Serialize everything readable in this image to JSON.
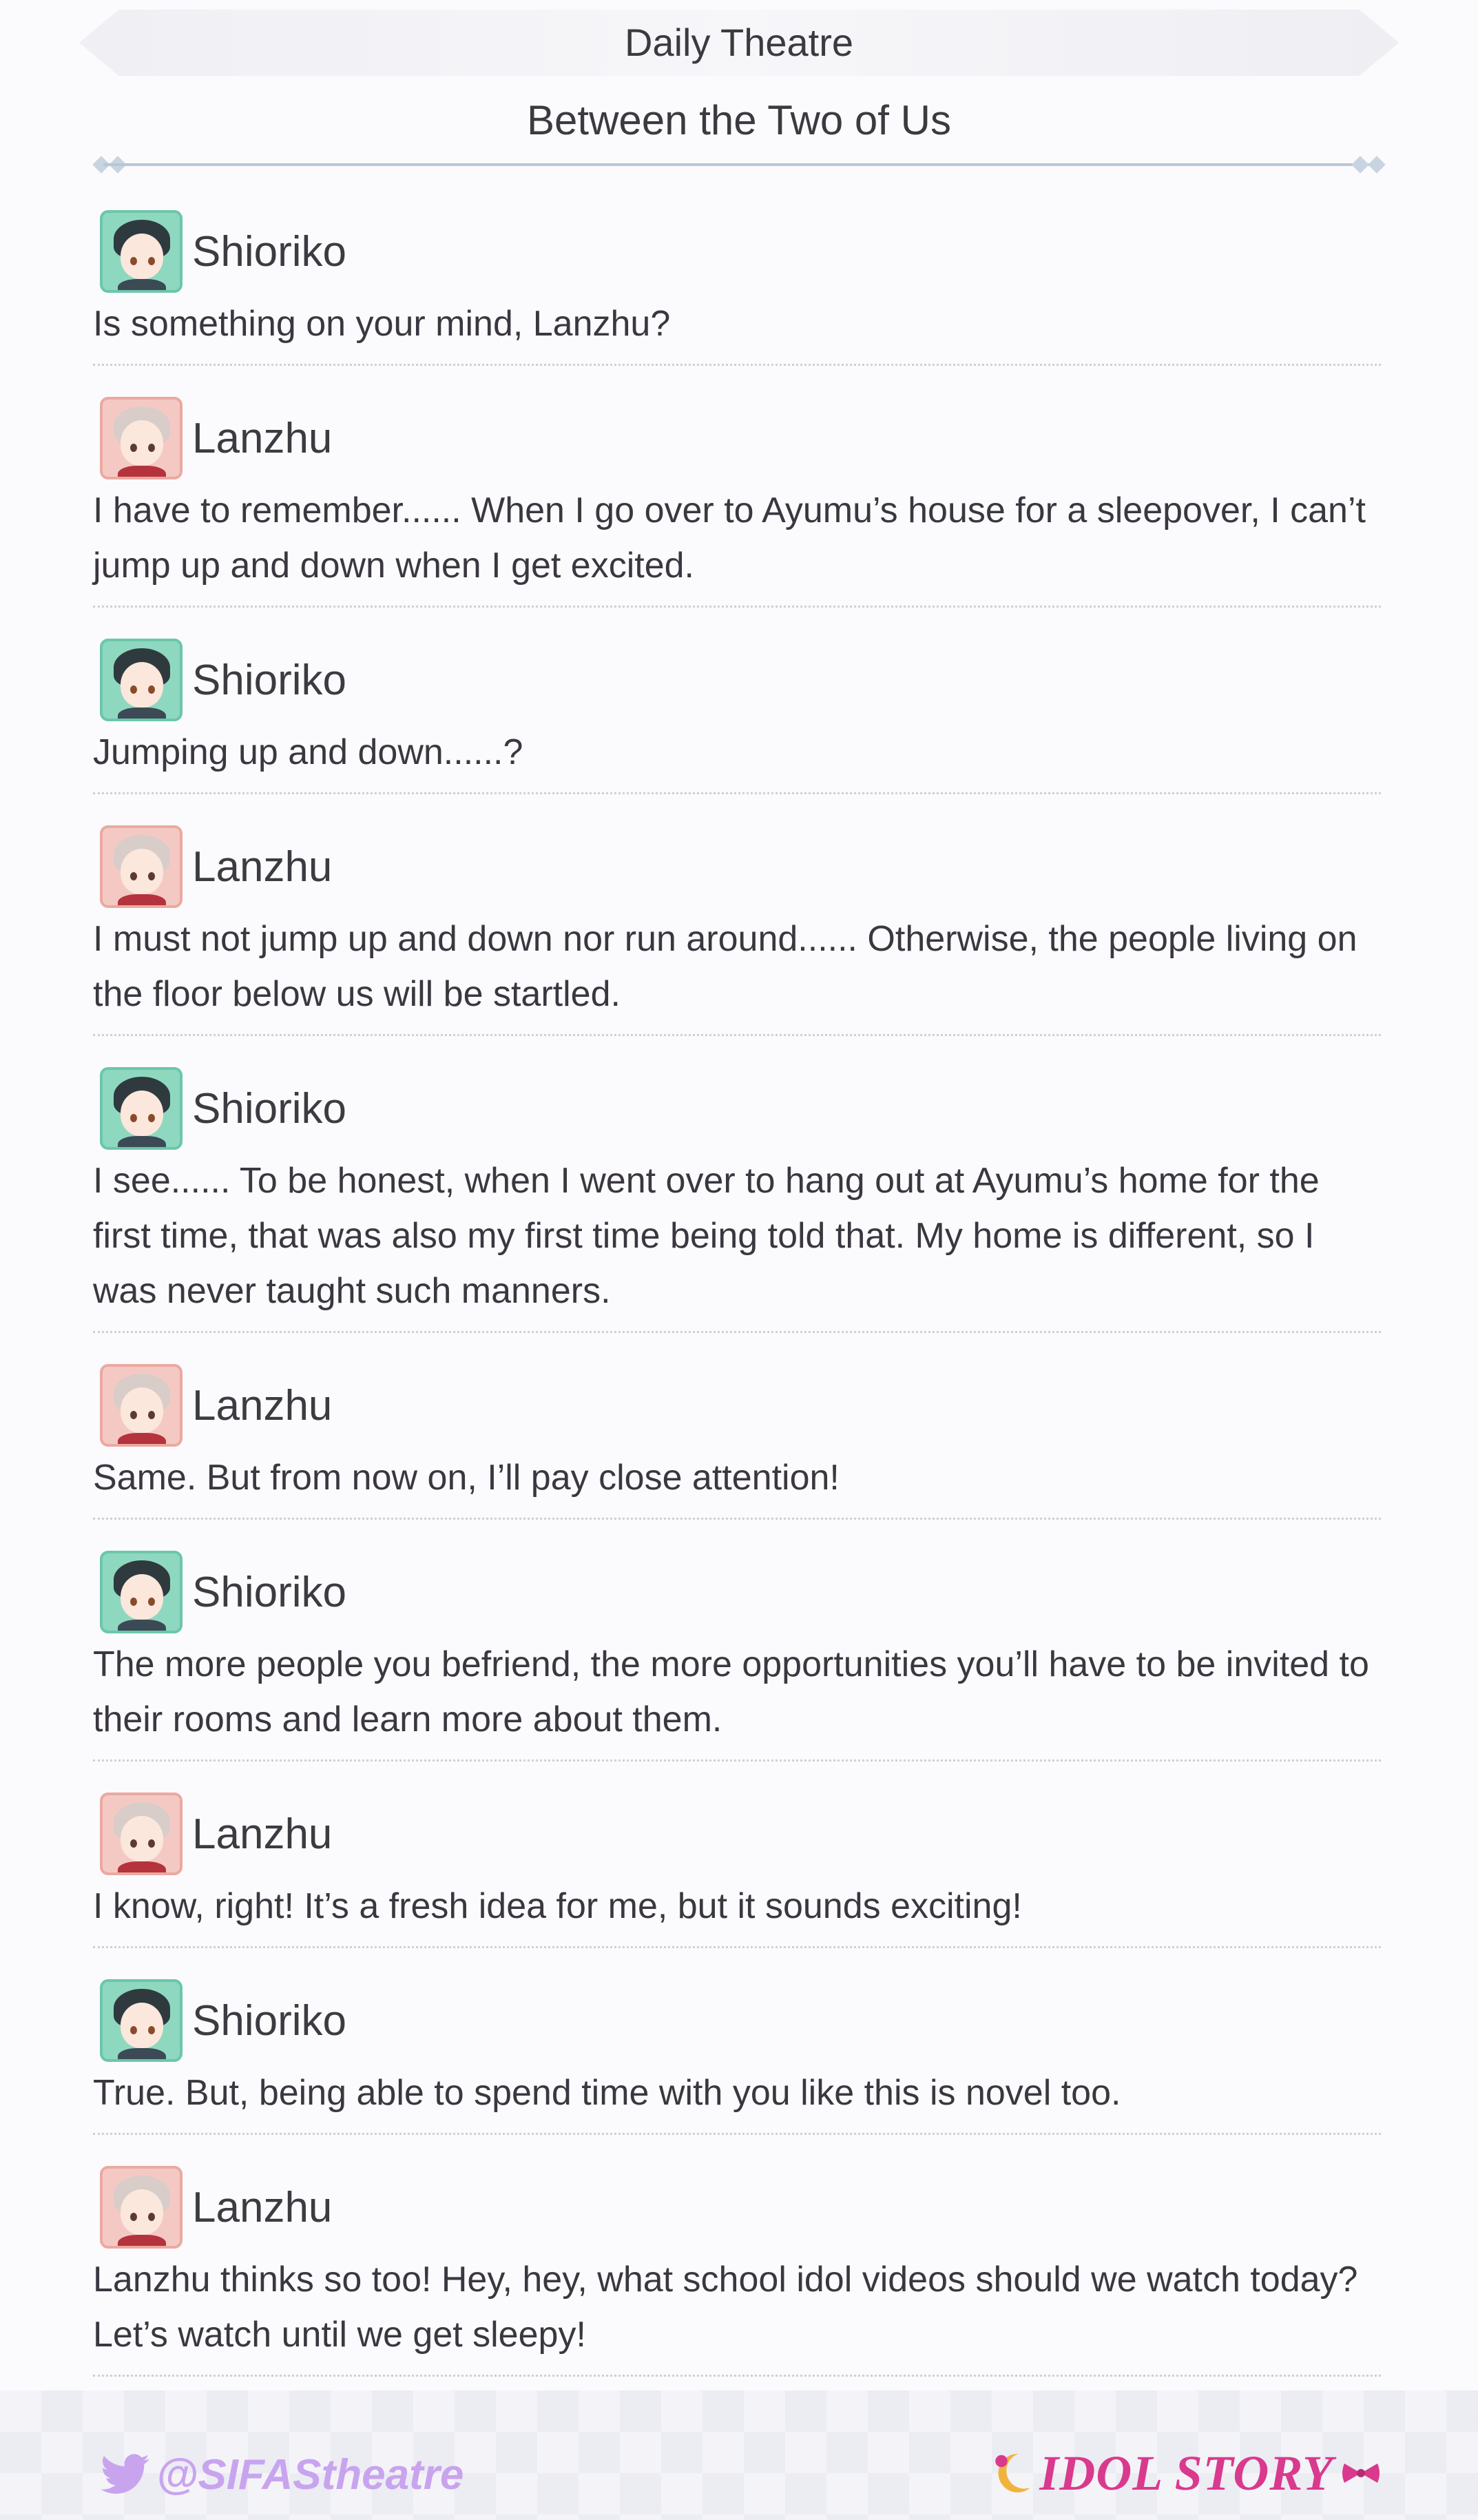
{
  "header": {
    "section_title": "Daily Theatre",
    "story_title": "Between the Two of Us"
  },
  "dialogue": [
    {
      "speaker": "Shioriko",
      "avatar": "shioriko",
      "text": "Is something on your mind, Lanzhu?"
    },
    {
      "speaker": "Lanzhu",
      "avatar": "lanzhu",
      "text": "I have to remember...... When I go over to Ayumu’s house for a sleepover, I can’t jump up and down when I get excited."
    },
    {
      "speaker": "Shioriko",
      "avatar": "shioriko",
      "text": "Jumping up and down......?"
    },
    {
      "speaker": "Lanzhu",
      "avatar": "lanzhu",
      "text": "I must not jump up and down nor run around...... Otherwise, the people living on the floor below us will be startled."
    },
    {
      "speaker": "Shioriko",
      "avatar": "shioriko",
      "text": "I see...... To be honest, when I went over to hang out at Ayumu’s home for the first time, that was also my first time being told that. My home is different, so I was never taught such manners."
    },
    {
      "speaker": "Lanzhu",
      "avatar": "lanzhu",
      "text": "Same. But from now on, I’ll pay close attention!"
    },
    {
      "speaker": "Shioriko",
      "avatar": "shioriko",
      "text": "The more people you befriend, the more opportunities you’ll have to be invited to their rooms and learn more about them."
    },
    {
      "speaker": "Lanzhu",
      "avatar": "lanzhu",
      "text": "I know, right! It’s a fresh idea for me, but it sounds exciting!"
    },
    {
      "speaker": "Shioriko",
      "avatar": "shioriko",
      "text": "True. But, being able to spend time with you like this is novel too."
    },
    {
      "speaker": "Lanzhu",
      "avatar": "lanzhu",
      "text": "Lanzhu thinks so too! Hey, hey, what school idol videos should we watch today? Let’s watch until we get sleepy!"
    }
  ],
  "footer": {
    "twitter_handle": "@SIFAStheatre",
    "brand": "IDOL STORY"
  },
  "colors": {
    "shioriko_accent": "#8ed8c0",
    "lanzhu_accent": "#f5c9c3",
    "handle": "#c9a4ee",
    "brand": "#d93a8d",
    "divider": "#b9c6d6"
  },
  "icons": {
    "twitter": "bird-icon",
    "brand_moon": "moon-icon",
    "brand_bow": "bow-icon"
  }
}
